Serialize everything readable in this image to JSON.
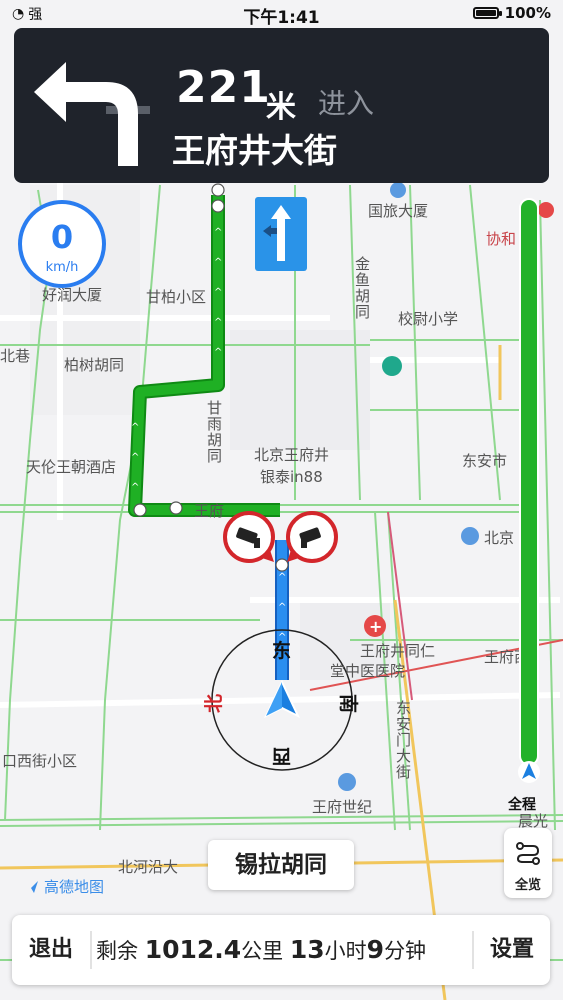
{
  "status_bar": {
    "signal": "强",
    "time": "下午1:41",
    "battery": "100%"
  },
  "turn_panel": {
    "distance_value": "221",
    "distance_unit": "米",
    "action": "进入",
    "road": "王府井大街",
    "icon": "turn-left-arrow-icon"
  },
  "speed": {
    "value": "0",
    "unit": "km/h"
  },
  "map_labels": {
    "guolv": "国旅大厦",
    "xiehe": "协和",
    "ganyu_hutong": "甘柏小区",
    "haoyun": "好润大厦",
    "jinyu": "金鱼胡同",
    "xiaowei": "校尉小学",
    "beixiang": "北巷",
    "baishu": "柏树胡同",
    "ganyu_road": "甘雨胡同",
    "tianlun": "天伦王朝酒店",
    "yintai_1": "北京王府井",
    "yintai_2": "银泰in88",
    "dongan": "东安市",
    "beijing_right": "北京",
    "wangfu_small": "王府",
    "hospital_1": "王府井同仁",
    "hospital_2": "堂中医医院",
    "wangfu_west": "王府西",
    "dongan_gate": "东安门大街",
    "xijie": "口西街小区",
    "wangfu_shiji": "王府世纪",
    "chenguang": "晨光",
    "beihe": "北河沿大"
  },
  "compass": {
    "north": "北",
    "east": "东",
    "south": "南",
    "west": "西"
  },
  "progress": {
    "fraction_remaining": 1.0,
    "label": "全程"
  },
  "next_road": "锡拉胡同",
  "overview_button": "全览",
  "brand": "高德地图",
  "bottom_bar": {
    "exit": "退出",
    "remaining_prefix": "剩余",
    "distance": "1012.4",
    "distance_unit": "公里",
    "hours": "13",
    "hours_unit": "小时",
    "minutes": "9",
    "minutes_unit": "分钟",
    "settings": "设置"
  },
  "colors": {
    "route_green": "#1fb024",
    "route_blue": "#2a8ef0",
    "panel_bg": "#1f232b",
    "accent_blue": "#2a7df0"
  }
}
